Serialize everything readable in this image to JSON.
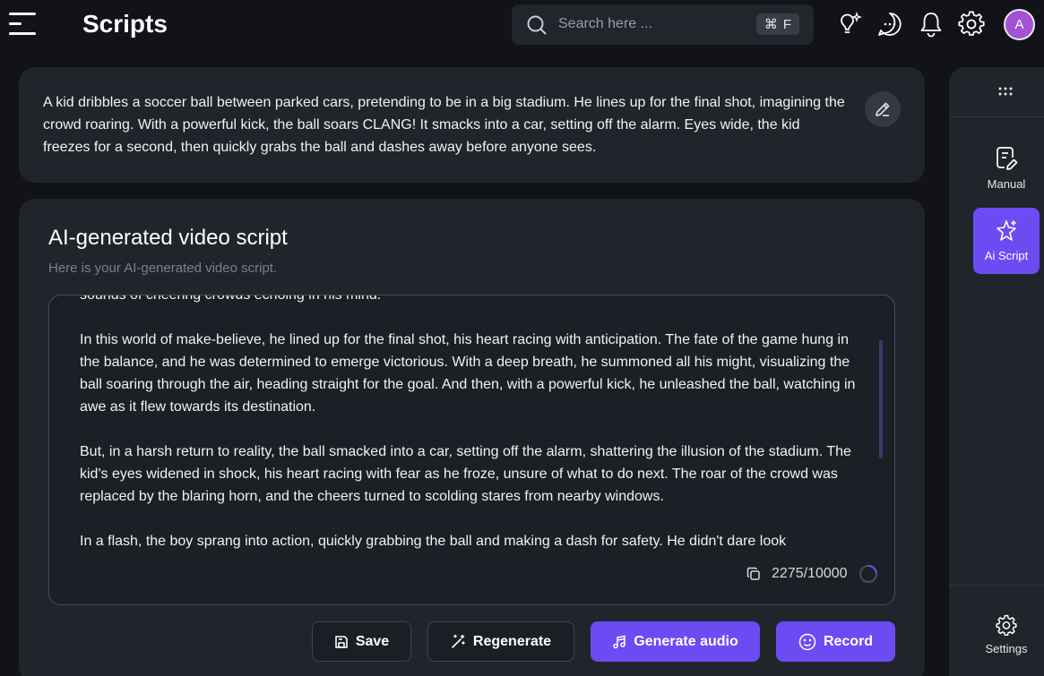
{
  "header": {
    "title": "Scripts",
    "search": {
      "placeholder": "Search here ...",
      "shortcut_symbol": "⌘",
      "shortcut_key": "F"
    },
    "icons": [
      "lightbulb-icon",
      "chat-icon",
      "bell-icon",
      "gear-icon"
    ],
    "avatar_initial": "A"
  },
  "prompt": {
    "text": "A kid dribbles a soccer ball between parked cars, pretending to be in a big stadium. He lines up for the final shot, imagining the crowd roaring. With a powerful kick, the ball soars CLANG! It smacks into a car, setting off the alarm. Eyes wide, the kid freezes for a second, then quickly grabs the ball and dashes away before anyone sees."
  },
  "script": {
    "title": "AI-generated video script",
    "subtitle": "Here is your AI-generated video script.",
    "paragraphs": [
      "sounds of cheering crowds echoing in his mind.",
      "In this world of make-believe, he lined up for the final shot, his heart racing with anticipation. The fate of the game hung in the balance, and he was determined to emerge victorious. With a deep breath, he summoned all his might, visualizing the ball soaring through the air, heading straight for the goal. And then, with a powerful kick, he unleashed the ball, watching in awe as it flew towards its destination.",
      "But, in a harsh return to reality, the ball smacked into a car, setting off the alarm, shattering the illusion of the stadium. The kid's eyes widened in shock, his heart racing with fear as he froze, unsure of what to do next. The roar of the crowd was replaced by the blaring horn, and the cheers turned to scolding stares from nearby windows.",
      "In a flash, the boy sprang into action, quickly grabbing the ball and making a dash for safety. He didn't dare look"
    ],
    "char_count": "2275/10000",
    "char_fraction": 0.2275
  },
  "actions": {
    "save": "Save",
    "regenerate": "Regenerate",
    "generate_audio": "Generate audio",
    "record": "Record"
  },
  "rail": {
    "manual": "Manual",
    "ai_script": "Ai Script",
    "settings": "Settings"
  },
  "colors": {
    "accent": "#6b4cf2",
    "background": "#121318",
    "card": "#22242c"
  }
}
